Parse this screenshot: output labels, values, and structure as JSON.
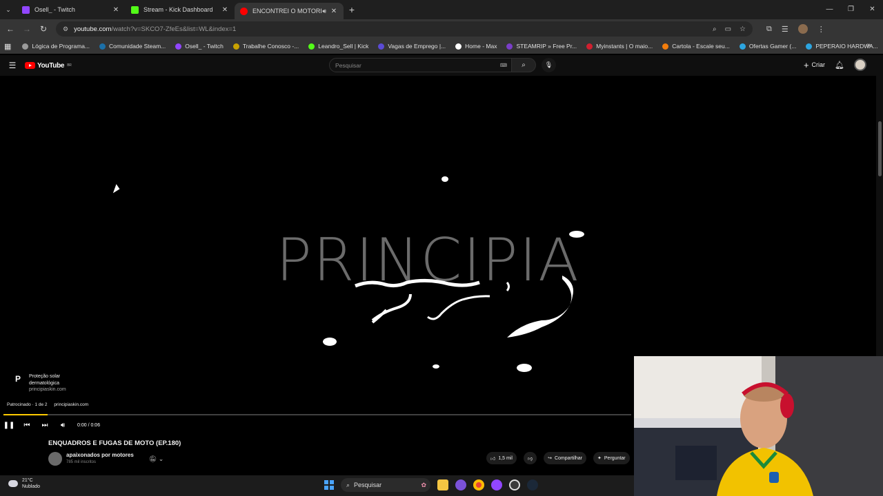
{
  "browser": {
    "tabs": [
      {
        "title": "Osell_ - Twitch",
        "favicon_color": "#9146ff",
        "active": false
      },
      {
        "title": "Stream - Kick Dashboard",
        "favicon_color": "#53fc18",
        "active": false
      },
      {
        "title": "ENCONTREI O MOTORISTA",
        "favicon_color": "#ff0000",
        "active": true
      }
    ],
    "url_host": "youtube.com",
    "url_path": "/watch?v=SKCO7-ZfeEs&list=WL&index=1",
    "bookmarks": [
      {
        "label": "Lógica de Programa...",
        "color": "#9b9b9b"
      },
      {
        "label": "Comunidade Steam...",
        "color": "#1b6fa8"
      },
      {
        "label": "Osell_ - Twitch",
        "color": "#9146ff"
      },
      {
        "label": "Trabalhe Conosco -...",
        "color": "#c8a200"
      },
      {
        "label": "Leandro_Sell | Kick",
        "color": "#53fc18"
      },
      {
        "label": "Vagas de Emprego |...",
        "color": "#5b4bd6"
      },
      {
        "label": "Home - Max",
        "color": "#ffffff"
      },
      {
        "label": "STEAMRIP » Free Pr...",
        "color": "#7a3ec8"
      },
      {
        "label": "Myinstants | O maio...",
        "color": "#d01f2f"
      },
      {
        "label": "Cartola - Escale seu...",
        "color": "#f27d0c"
      },
      {
        "label": "Ofertas Gamer (...",
        "color": "#2ca5e0"
      },
      {
        "label": "PEPERAIO HARDWA...",
        "color": "#2ca5e0"
      }
    ]
  },
  "youtube": {
    "logo_text": "YouTube",
    "region": "BR",
    "search_placeholder": "Pesquisar",
    "create_label": "Criar",
    "video": {
      "overlay_text": "PRINCIPIA",
      "sponsor_name_line1": "Proteção solar",
      "sponsor_name_line2": "dermatológica",
      "sponsor_url": "principiaskin.com",
      "sponsor_logo": "P",
      "sponsored_label": "Patrocinado · 1 de 2",
      "sponsored_link": "principiaskin.com",
      "time": "0:00 / 0:06",
      "progress": 0.07
    },
    "title": "ENQUADROS E FUGAS DE MOTO (EP.180)",
    "channel_name": "apaixonados por motores",
    "subscribers": "785 mil inscritos",
    "likes": "1,5 mil",
    "share_label": "Compartilhar",
    "ask_label": "Perguntar"
  },
  "taskbar": {
    "temperature": "21°C",
    "weather_text": "Nublado",
    "search_label": "Pesquisar"
  }
}
